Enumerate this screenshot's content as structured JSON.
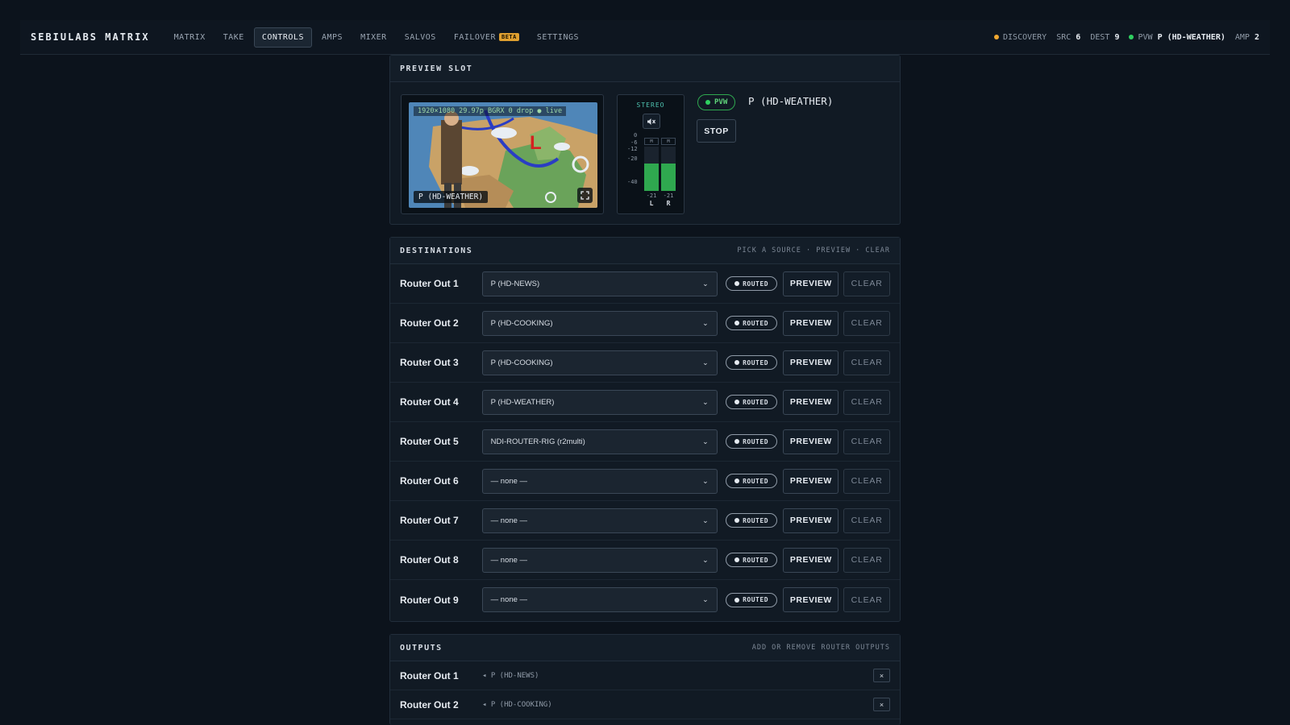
{
  "app": {
    "brand": "SEBIULABS MATRIX"
  },
  "nav": [
    {
      "label": "MATRIX",
      "active": false
    },
    {
      "label": "TAKE",
      "active": false
    },
    {
      "label": "CONTROLS",
      "active": true
    },
    {
      "label": "AMPS",
      "active": false
    },
    {
      "label": "MIXER",
      "active": false
    },
    {
      "label": "SALVOS",
      "active": false
    },
    {
      "label": "FAILOVER",
      "active": false,
      "badge": "BETA"
    },
    {
      "label": "SETTINGS",
      "active": false
    }
  ],
  "status": {
    "discovery_label": "DISCOVERY",
    "discovery_color": "#f0a830",
    "src_label": "SRC",
    "src_value": "6",
    "dest_label": "DEST",
    "dest_value": "9",
    "pvw_label": "PVW",
    "pvw_value": "P (HD-WEATHER)",
    "pvw_color": "#2fd060",
    "amp_label": "AMP",
    "amp_value": "2"
  },
  "preview_slot": {
    "title": "PREVIEW SLOT",
    "video_info": "1920×1080 29.97p BGRX 0 drop ● live",
    "video_label": "P (HD-WEATHER)",
    "fullscreen_icon": "fullscreen-icon",
    "audio": {
      "mode": "STEREO",
      "mute_icon": "speaker-mute-icon",
      "scale": [
        "0",
        "-6",
        "-12",
        "-20",
        "-40"
      ],
      "channels": [
        {
          "name": "L",
          "tag": "M",
          "peak": "-21",
          "level": 0.62
        },
        {
          "name": "R",
          "tag": "M",
          "peak": "-21",
          "level": 0.62
        }
      ]
    },
    "pvw_badge": "PVW",
    "pvw_source": "P (HD-WEATHER)",
    "stop_label": "STOP"
  },
  "destinations": {
    "title": "DESTINATIONS",
    "hint": "PICK A SOURCE · PREVIEW · CLEAR",
    "routed_label": "ROUTED",
    "preview_label": "PREVIEW",
    "clear_label": "CLEAR",
    "rows": [
      {
        "name": "Router Out 1",
        "source": "P (HD-NEWS)"
      },
      {
        "name": "Router Out 2",
        "source": "P (HD-COOKING)"
      },
      {
        "name": "Router Out 3",
        "source": "P (HD-COOKING)"
      },
      {
        "name": "Router Out 4",
        "source": "P (HD-WEATHER)"
      },
      {
        "name": "Router Out 5",
        "source": "NDI-ROUTER-RIG (r2multi)"
      },
      {
        "name": "Router Out 6",
        "source": "— none —"
      },
      {
        "name": "Router Out 7",
        "source": "— none —"
      },
      {
        "name": "Router Out 8",
        "source": "— none —"
      },
      {
        "name": "Router Out 9",
        "source": "— none —"
      }
    ]
  },
  "outputs": {
    "title": "OUTPUTS",
    "hint": "ADD OR REMOVE ROUTER OUTPUTS",
    "rows": [
      {
        "name": "Router Out 1",
        "source": "◂ P (HD-NEWS)",
        "remove": "×"
      },
      {
        "name": "Router Out 2",
        "source": "◂ P (HD-COOKING)",
        "remove": "×"
      }
    ]
  }
}
